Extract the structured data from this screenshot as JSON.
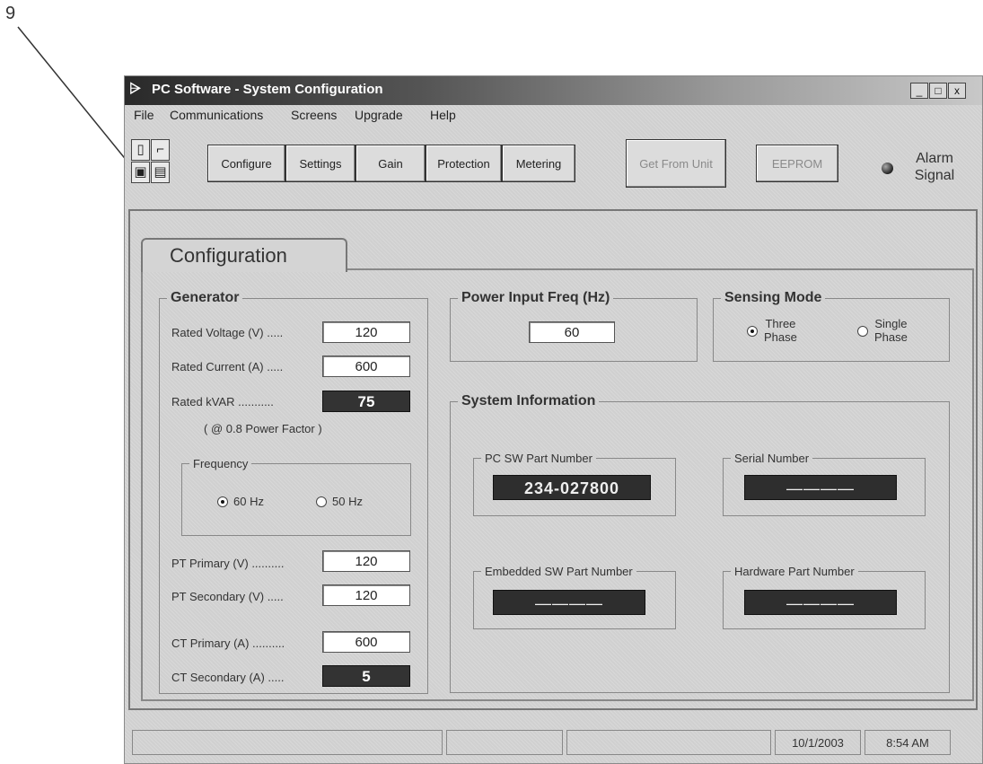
{
  "callout": "9",
  "window": {
    "title": "PC Software - System Configuration",
    "controls": [
      "_",
      "□",
      "x"
    ]
  },
  "menu": [
    "File",
    "Communications",
    "Screens",
    "Upgrade",
    "Help"
  ],
  "toolbar": {
    "icons": [
      "new-file-icon",
      "open-folder-icon",
      "save-icon",
      "print-icon"
    ],
    "buttons": [
      "Configure",
      "Settings",
      "Gain",
      "Protection",
      "Metering"
    ],
    "get_from_unit": "Get From Unit",
    "eeprom": "EEPROM",
    "alarm_line1": "Alarm",
    "alarm_line2": "Signal"
  },
  "tab": {
    "label": "Configuration"
  },
  "generator": {
    "title": "Generator",
    "rated_voltage_label": "Rated Voltage (V) .....",
    "rated_voltage": "120",
    "rated_current_label": "Rated Current (A) .....",
    "rated_current": "600",
    "rated_kvar_label": "Rated kVAR ...........",
    "rated_kvar": "75",
    "power_factor_note": "( @ 0.8 Power Factor )",
    "frequency": {
      "title": "Frequency",
      "opt_60": "60 Hz",
      "opt_50": "50 Hz",
      "selected": "60 Hz"
    },
    "pt_primary_label": "PT Primary (V) ..........",
    "pt_primary": "120",
    "pt_secondary_label": "PT Secondary (V) .....",
    "pt_secondary": "120",
    "ct_primary_label": "CT Primary (A) ..........",
    "ct_primary": "600",
    "ct_secondary_label": "CT Secondary (A) .....",
    "ct_secondary": "5"
  },
  "power_input": {
    "title": "Power Input Freq (Hz)",
    "value": "60"
  },
  "sensing_mode": {
    "title": "Sensing Mode",
    "three_line1": "Three",
    "three_line2": "Phase",
    "single_line1": "Single",
    "single_line2": "Phase",
    "selected": "Three Phase"
  },
  "system_info": {
    "title": "System Information",
    "pc_sw_label": "PC SW Part Number",
    "pc_sw_value": "234-027800",
    "serial_label": "Serial Number",
    "serial_value": "————",
    "embedded_label": "Embedded SW Part Number",
    "embedded_value": "————",
    "hardware_label": "Hardware Part Number",
    "hardware_value": "————"
  },
  "status": {
    "date": "10/1/2003",
    "time": "8:54 AM"
  }
}
